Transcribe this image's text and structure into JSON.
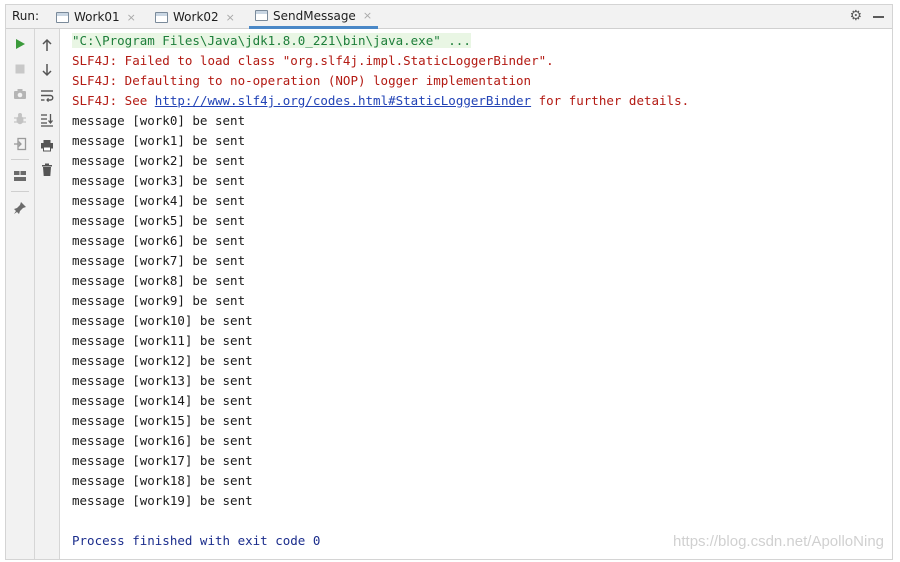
{
  "header": {
    "run_label": "Run:",
    "tabs": [
      {
        "label": "Work01"
      },
      {
        "label": "Work02"
      },
      {
        "label": "SendMessage"
      }
    ],
    "close_glyph": "×"
  },
  "toolbar_icons": [
    "rerun-icon",
    "stop-icon",
    "camera-icon",
    "debug-icon",
    "exit-icon",
    "layout-icon",
    "pin-icon",
    "arrow-up-icon",
    "arrow-down-icon",
    "soft-wrap-icon",
    "scroll-to-end-icon",
    "print-icon",
    "trash-icon"
  ],
  "console": {
    "command": "\"C:\\Program Files\\Java\\jdk1.8.0_221\\bin\\java.exe\" ...",
    "slf4j_1": "SLF4J: Failed to load class \"org.slf4j.impl.StaticLoggerBinder\".",
    "slf4j_2": "SLF4J: Defaulting to no-operation (NOP) logger implementation",
    "slf4j_3_prefix": "SLF4J: See ",
    "slf4j_3_link": "http://www.slf4j.org/codes.html#StaticLoggerBinder",
    "slf4j_3_suffix": " for further details.",
    "messages": [
      "message [work0] be sent",
      "message [work1] be sent",
      "message [work2] be sent",
      "message [work3] be sent",
      "message [work4] be sent",
      "message [work5] be sent",
      "message [work6] be sent",
      "message [work7] be sent",
      "message [work8] be sent",
      "message [work9] be sent",
      "message [work10] be sent",
      "message [work11] be sent",
      "message [work12] be sent",
      "message [work13] be sent",
      "message [work14] be sent",
      "message [work15] be sent",
      "message [work16] be sent",
      "message [work17] be sent",
      "message [work18] be sent",
      "message [work19] be sent"
    ],
    "finished": "Process finished with exit code 0"
  },
  "watermark": "https://blog.csdn.net/ApolloNing",
  "colors": {
    "run_green": "#3b9a3b",
    "stdout": "#1b1b1b",
    "stderr": "#b31a13",
    "command": "#1d7e3a",
    "link": "#2243b6",
    "finished": "#1b2d8c",
    "active_tab_underline": "#4a88c7"
  }
}
